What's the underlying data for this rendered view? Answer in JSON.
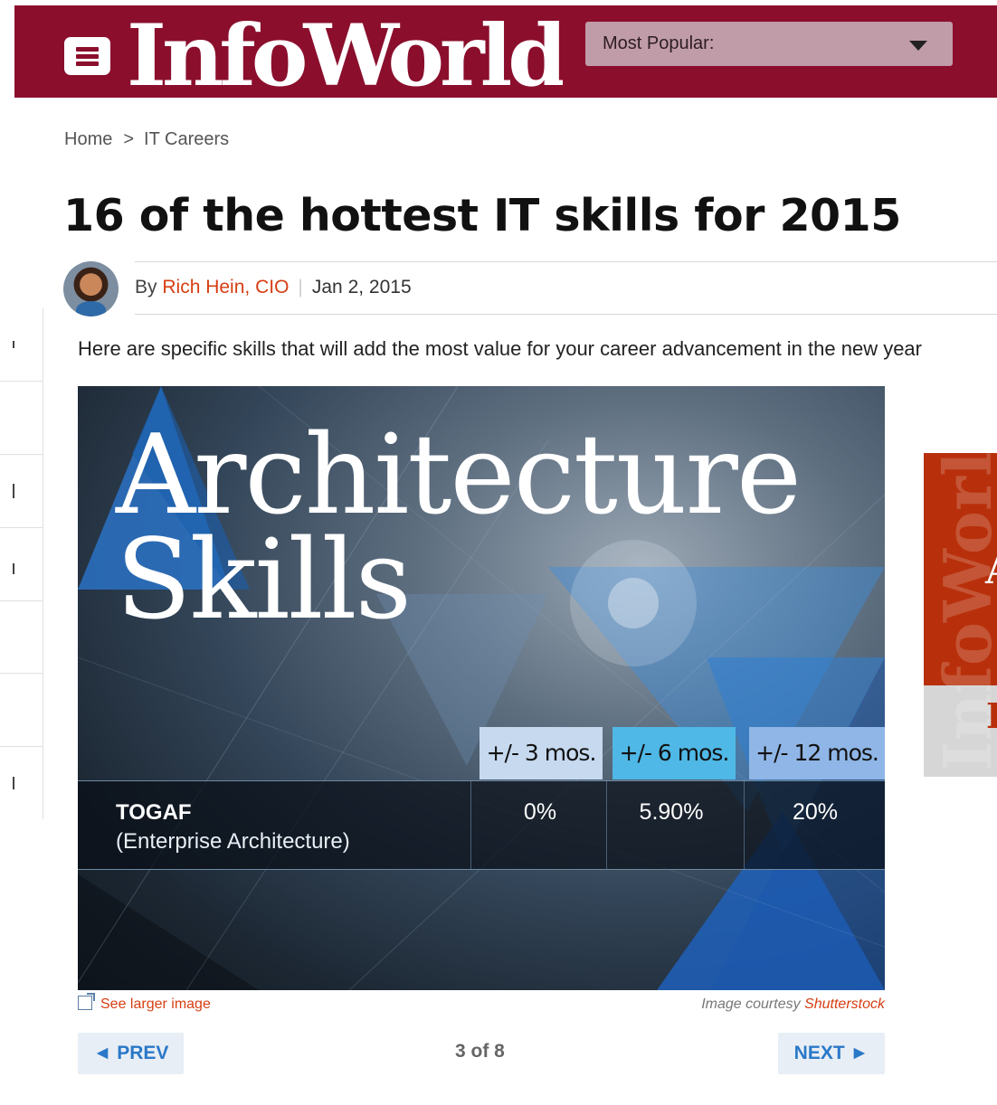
{
  "header": {
    "logo": "InfoWorld",
    "menu_icon": "hamburger-icon",
    "popular_label": "Most Popular:",
    "brand_color": "#8b0e2d"
  },
  "breadcrumb": {
    "home": "Home",
    "separator": ">",
    "section": "IT Careers"
  },
  "article": {
    "title": "16 of the hottest IT skills for 2015",
    "by": "By",
    "author": "Rich Hein, CIO",
    "date": "Jan 2, 2015",
    "dek": "Here are specific skills that will add the most value for your career advancement in the new year"
  },
  "slide": {
    "title_line1": "Architecture",
    "title_line2": "Skills",
    "columns": [
      {
        "label": "+/- 3 mos.",
        "color": "#c6d9ef"
      },
      {
        "label": "+/- 6 mos.",
        "color": "#4fb8e6"
      },
      {
        "label": "+/- 12 mos.",
        "color": "#8fb6e6"
      }
    ],
    "row": {
      "skill": "TOGAF",
      "subtitle": "(Enterprise Architecture)",
      "values": [
        "0%",
        "5.90%",
        "20%"
      ]
    }
  },
  "caption": {
    "larger_label": "See larger image",
    "courtesy": "Image courtesy",
    "source": "Shutterstock"
  },
  "pager": {
    "prev": "◄ PREV",
    "current": "3",
    "of": "of 8",
    "next": "NEXT ►"
  },
  "ad": {
    "watermark": "InfoWorld",
    "letter_a": "A",
    "letter_i": "I"
  }
}
